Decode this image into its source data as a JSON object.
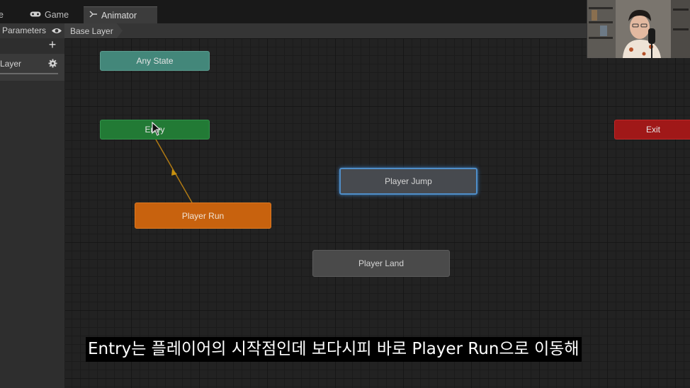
{
  "tabs": [
    {
      "label": "e"
    },
    {
      "label": "Game",
      "icon": "gamepad-icon"
    },
    {
      "label": "Animator",
      "icon": "animator-icon"
    }
  ],
  "parameters": {
    "label": "Parameters"
  },
  "breadcrumb": {
    "label": "Base Layer"
  },
  "layers": {
    "add_label": "+",
    "layer_name": "Layer"
  },
  "states": {
    "any_state": "Any State",
    "entry": "Entry",
    "exit": "Exit",
    "player_run": "Player Run",
    "player_jump": "Player Jump",
    "player_land": "Player Land"
  },
  "colors": {
    "any_state": "#43877a",
    "entry": "#227a35",
    "exit": "#a01818",
    "default_state": "#c8620e",
    "selected_outline": "#4f8ec9"
  },
  "subtitle": "Entry는 플레이어의 시작점인데 보다시피 바로 Player Run으로 이동해"
}
